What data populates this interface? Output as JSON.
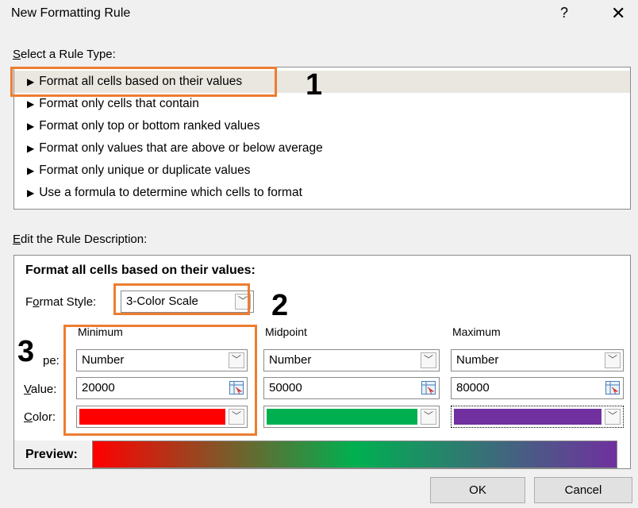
{
  "dialog": {
    "title": "New Formatting Rule",
    "help_label": "?",
    "close_label": "✕"
  },
  "select_rule": {
    "label_u": "S",
    "label_rest": "elect a Rule Type:",
    "items": [
      {
        "label": "Format all cells based on their values",
        "selected": true
      },
      {
        "label": "Format only cells that contain",
        "selected": false
      },
      {
        "label": "Format only top or bottom ranked values",
        "selected": false
      },
      {
        "label": "Format only values that are above or below average",
        "selected": false
      },
      {
        "label": "Format only unique or duplicate values",
        "selected": false
      },
      {
        "label": "Use a formula to determine which cells to format",
        "selected": false
      }
    ]
  },
  "edit_rule": {
    "label_u": "E",
    "label_rest": "dit the Rule Description:",
    "heading": "Format all cells based on their values:",
    "format_style": {
      "label_pre": "F",
      "label_u": "o",
      "label_rest": "rmat Style:",
      "value": "3-Color Scale"
    },
    "row_labels": {
      "type_rest": "pe:",
      "value_u": "V",
      "value_rest": "alue:",
      "color_u": "C",
      "color_rest": "olor:"
    },
    "columns": [
      {
        "header": "Minimum",
        "type": "Number",
        "value": "20000",
        "color": "#ff0000"
      },
      {
        "header": "Midpoint",
        "type": "Number",
        "value": "50000",
        "color": "#00b050"
      },
      {
        "header": "Maximum",
        "type": "Number",
        "value": "80000",
        "color": "#7030a0"
      }
    ],
    "preview_label": "Preview:"
  },
  "annotations": {
    "n1": "1",
    "n2": "2",
    "n3": "3",
    "callout_color": "#ed7d31"
  },
  "buttons": {
    "ok": "OK",
    "cancel": "Cancel"
  }
}
